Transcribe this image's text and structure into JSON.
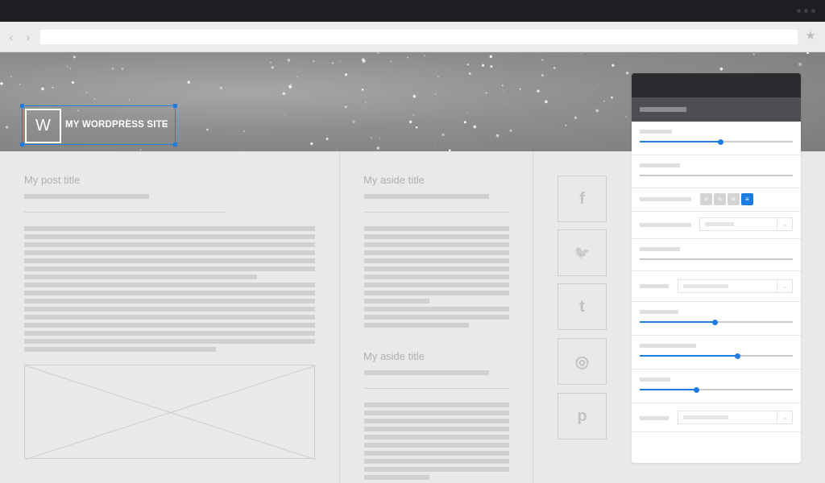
{
  "browser": {
    "back_icon": "chevron-left-icon",
    "forward_icon": "chevron-right-icon",
    "back_glyph": "‹",
    "forward_glyph": "›",
    "url": "",
    "bookmark_icon": "star-icon",
    "bookmark_glyph": "★"
  },
  "site": {
    "logo_letter": "W",
    "name": "MY WORDPRESS SITE"
  },
  "post": {
    "title": "My post title"
  },
  "aside": {
    "title_1": "My aside title",
    "title_2": "My aside title"
  },
  "social": [
    {
      "icon": "facebook-icon",
      "glyph": "f"
    },
    {
      "icon": "twitter-icon",
      "glyph": "🐦"
    },
    {
      "icon": "tumblr-icon",
      "glyph": "t"
    },
    {
      "icon": "dribbble-icon",
      "glyph": "◎"
    },
    {
      "icon": "pinterest-icon",
      "glyph": "p"
    }
  ],
  "customizer": {
    "align_glyph": "≡",
    "chevron_glyph": "⌄",
    "sliders": [
      {
        "value": 0.53
      },
      {
        "value": 0.49
      },
      {
        "value": 0.64
      },
      {
        "value": 0.37
      }
    ],
    "active_alignment": "justify",
    "colors": {
      "accent": "#1e7be0",
      "panel_header": "#2a2b2e",
      "panel_subheader": "#4d4e51"
    }
  }
}
